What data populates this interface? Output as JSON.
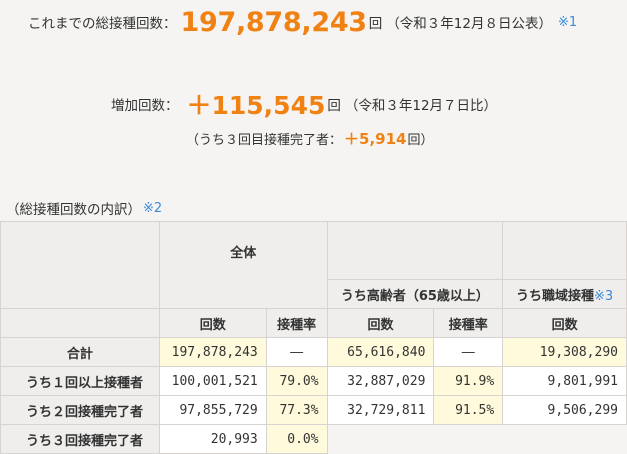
{
  "summary": {
    "total_label": "これまでの総接種回数：",
    "total_value": "197,878,243",
    "total_unit": "回",
    "total_date": "（令和３年12月８日公表）",
    "note1": "※1",
    "increase_label": "増加回数：",
    "increase_value": "＋115,545",
    "increase_unit": "回",
    "increase_date": "（令和３年12月７日比）",
    "third_dose_open": "（うち３回目接種完了者：",
    "third_dose_value": "＋5,914",
    "third_dose_close": "回）"
  },
  "breakdown": {
    "title": "（総接種回数の内訳）",
    "note2": "※2"
  },
  "table": {
    "group_all": "全体",
    "group_elderly": "うち高齢者（65歳以上）",
    "group_workplace": "うち職域接種",
    "note3": "※3",
    "col_count": "回数",
    "col_rate": "接種率",
    "rows": [
      {
        "label": "合計",
        "all_count": "197,878,243",
        "all_rate": "―",
        "elderly_count": "65,616,840",
        "elderly_rate": "―",
        "work_count": "19,308,290"
      },
      {
        "label": "うち１回以上接種者",
        "all_count": "100,001,521",
        "all_rate": "79.0%",
        "elderly_count": "32,887,029",
        "elderly_rate": "91.9%",
        "work_count": "9,801,991"
      },
      {
        "label": "うち２回接種完了者",
        "all_count": "97,855,729",
        "all_rate": "77.3%",
        "elderly_count": "32,729,811",
        "elderly_rate": "91.5%",
        "work_count": "9,506,299"
      },
      {
        "label": "うち３回接種完了者",
        "all_count": "20,993",
        "all_rate": "0.0%"
      }
    ]
  },
  "colors": {
    "accent_orange": "#f08214",
    "note_blue": "#3b8ad8",
    "highlight_yellow": "#fefadb",
    "header_gray": "#efeeec"
  }
}
